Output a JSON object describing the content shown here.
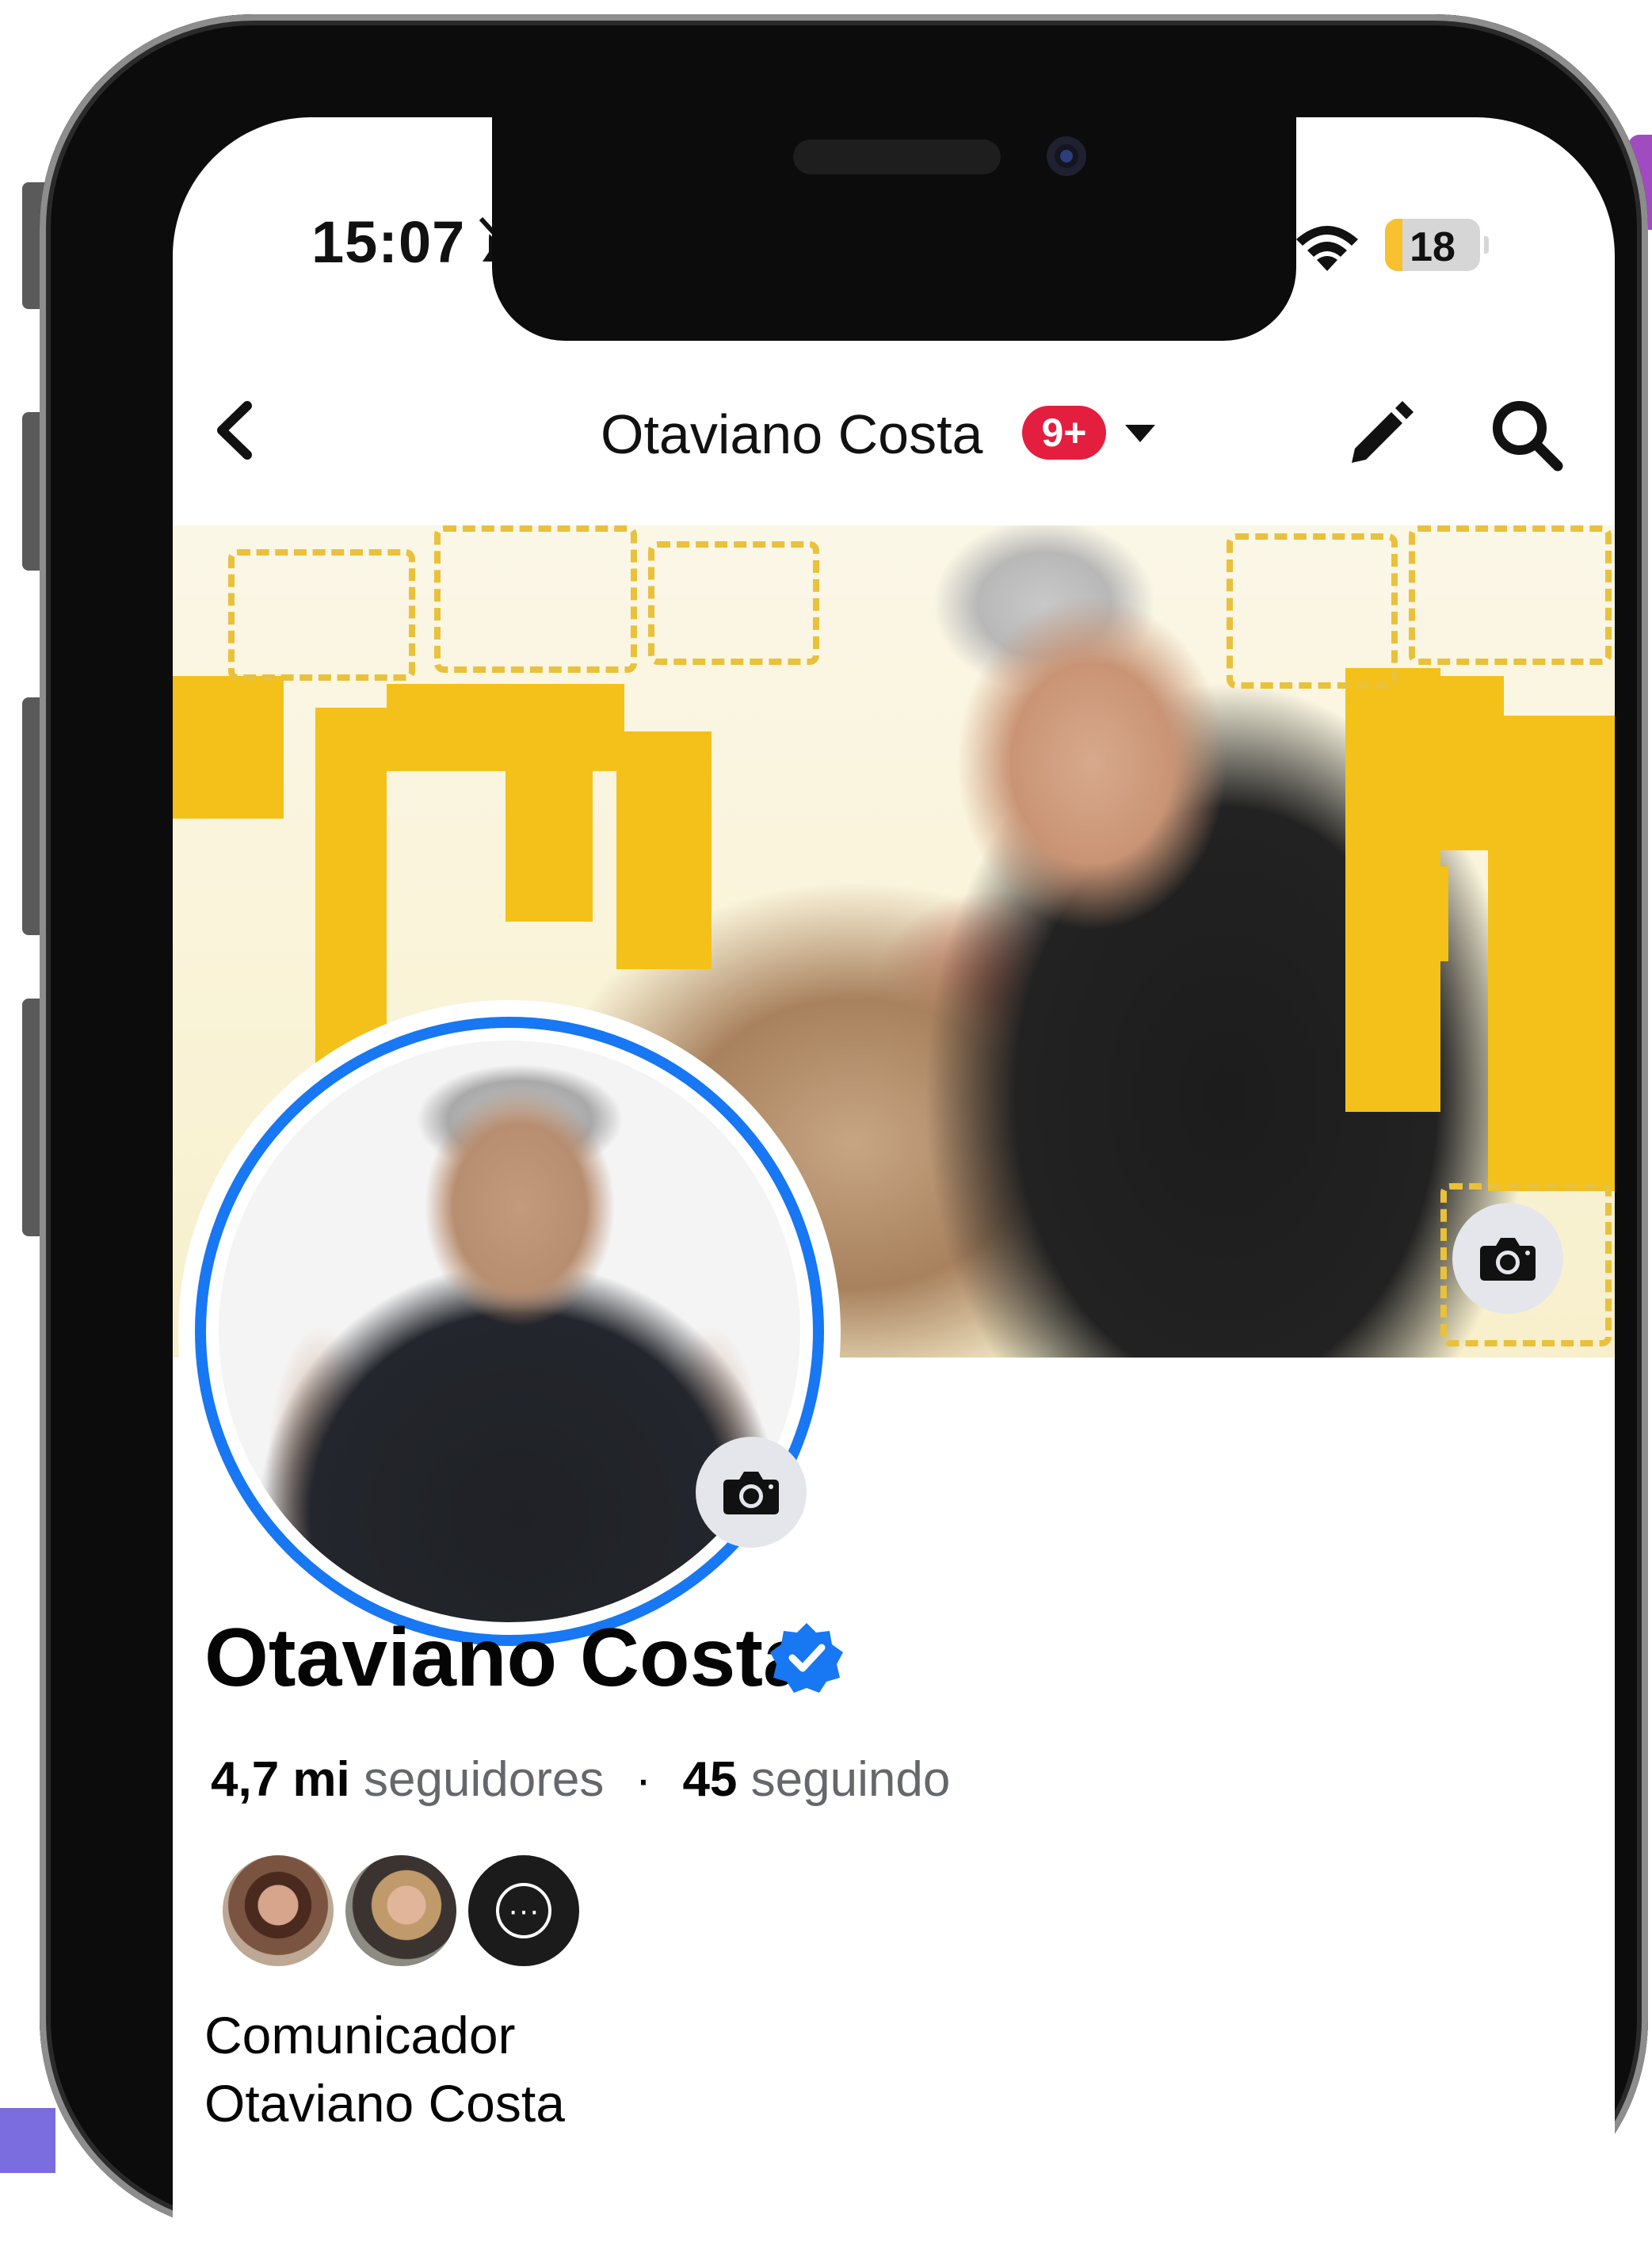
{
  "status_bar": {
    "time": "15:07",
    "battery_level": "18",
    "battery_fraction": 0.18,
    "icons": [
      "bell-off-icon",
      "cellular-signal-icon",
      "wifi-icon",
      "battery-icon"
    ]
  },
  "nav": {
    "title": "Otaviano Costa",
    "badge": "9+",
    "icons": [
      "chevron-left-icon",
      "caret-down-icon",
      "pencil-icon",
      "search-icon"
    ]
  },
  "profile": {
    "name": "Otaviano Costa",
    "verified_icon": "verified-badge-icon",
    "followers_count": "4,7 mi",
    "followers_label": "seguidores",
    "separator": "·",
    "following_count": "45",
    "following_label": "seguindo",
    "more_friends_glyph": "···",
    "bio_line1": "Comunicador",
    "bio_line2": "Otaviano Costa"
  },
  "colors": {
    "accent_blue": "#1877f2",
    "badge_red": "#e41e3f",
    "battery_yellow": "#f7c12f",
    "cover_yellow": "#f3c11a"
  }
}
